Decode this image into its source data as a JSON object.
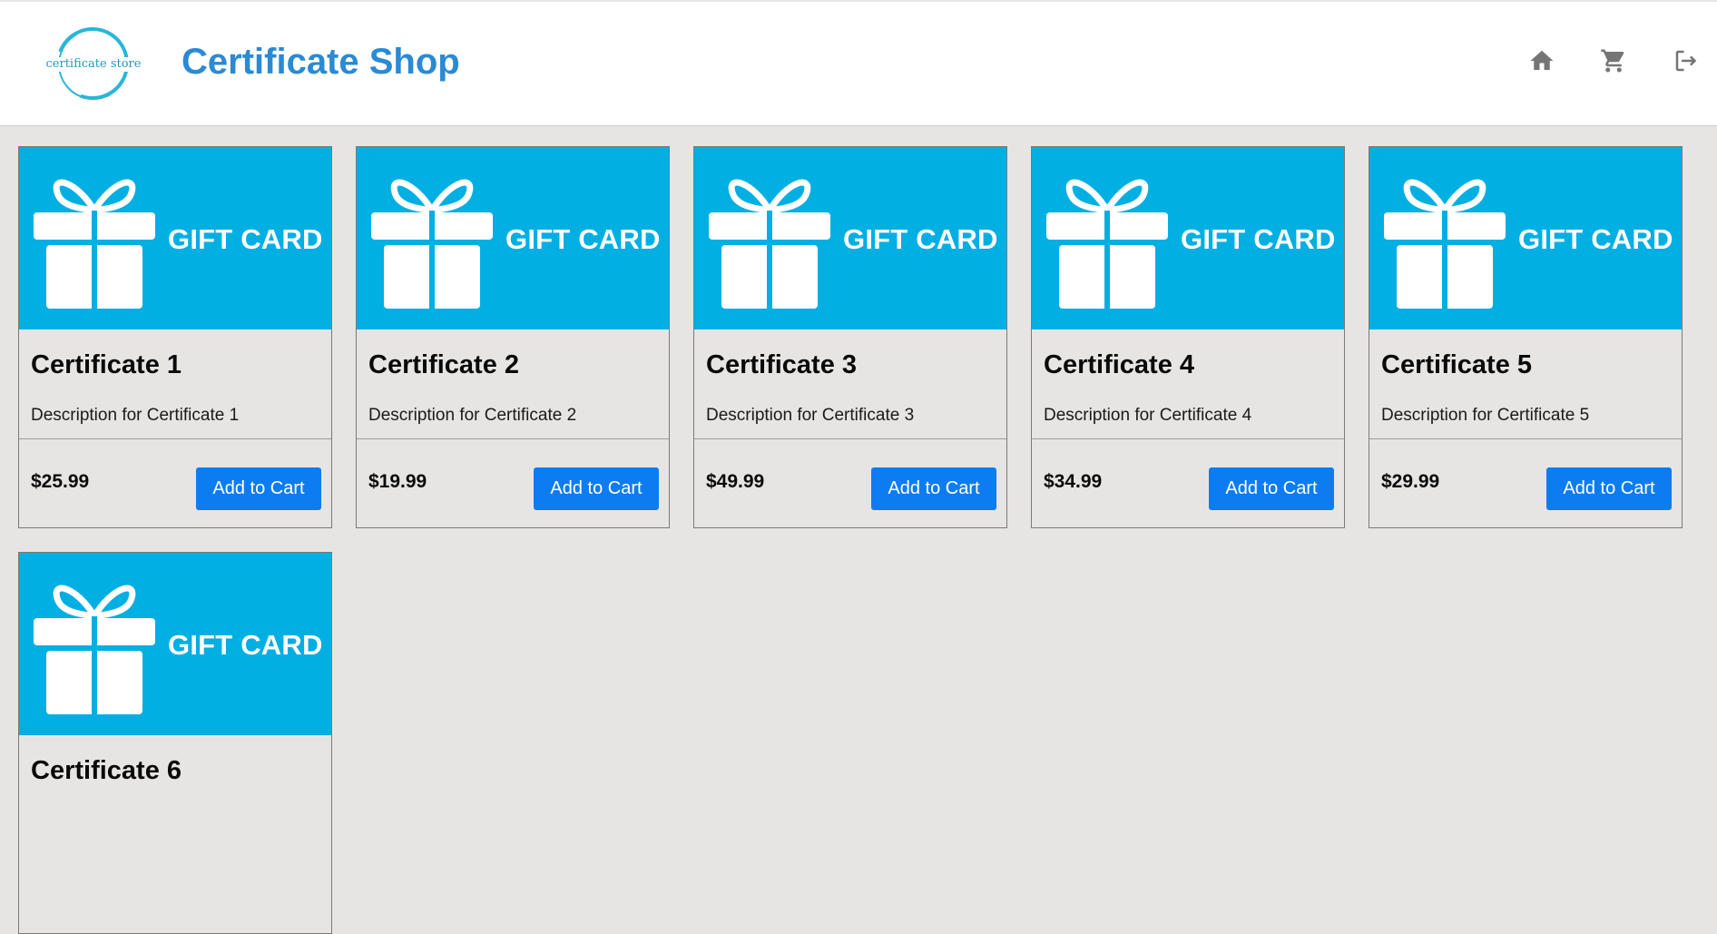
{
  "header": {
    "logo_text": "certificate store",
    "title": "Certificate Shop",
    "nav": [
      {
        "icon": "home-icon"
      },
      {
        "icon": "cart-icon"
      },
      {
        "icon": "logout-icon"
      }
    ]
  },
  "colors": {
    "brand_title": "#2a8ad4",
    "card_image_bg": "#02afe2",
    "button_bg": "#0d7cf0",
    "page_bg": "#e7e5e4"
  },
  "card_image_text": "GIFT CARD",
  "products": [
    {
      "name": "Certificate 1",
      "description": "Description for Certificate 1",
      "price": "$25.99",
      "button": "Add to Cart"
    },
    {
      "name": "Certificate 2",
      "description": "Description for Certificate 2",
      "price": "$19.99",
      "button": "Add to Cart"
    },
    {
      "name": "Certificate 3",
      "description": "Description for Certificate 3",
      "price": "$49.99",
      "button": "Add to Cart"
    },
    {
      "name": "Certificate 4",
      "description": "Description for Certificate 4",
      "price": "$34.99",
      "button": "Add to Cart"
    },
    {
      "name": "Certificate 5",
      "description": "Description for Certificate 5",
      "price": "$29.99",
      "button": "Add to Cart"
    },
    {
      "name": "Certificate 6"
    }
  ]
}
